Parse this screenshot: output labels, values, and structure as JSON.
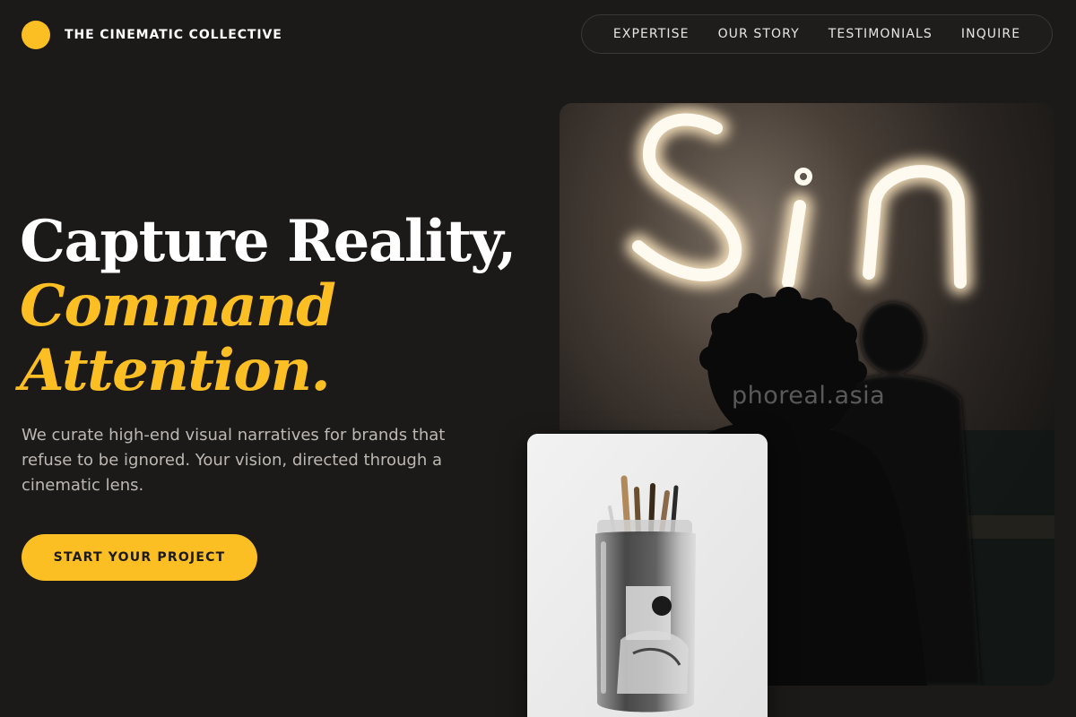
{
  "header": {
    "brand_name": "THE CINEMATIC COLLECTIVE",
    "brand_color": "#fbbf24",
    "nav": [
      {
        "label": "EXPERTISE"
      },
      {
        "label": "OUR STORY"
      },
      {
        "label": "TESTIMONIALS"
      },
      {
        "label": "INQUIRE"
      }
    ]
  },
  "hero": {
    "headline_line1": "Capture Reality,",
    "headline_line2": "Command",
    "headline_line3": "Attention.",
    "description": "We curate high-end visual narratives for brands that refuse to be ignored. Your vision, directed through a cinematic lens.",
    "cta_label": "START YOUR PROJECT"
  },
  "images": {
    "main": {
      "neon_text": "Sin",
      "watermark": "phoreal.asia"
    },
    "card": {
      "subject": "glass jar with brushes"
    }
  },
  "colors": {
    "background": "#1c1a19",
    "accent": "#fbbf24",
    "text": "#ffffff",
    "muted_text": "#bdb8b3"
  }
}
